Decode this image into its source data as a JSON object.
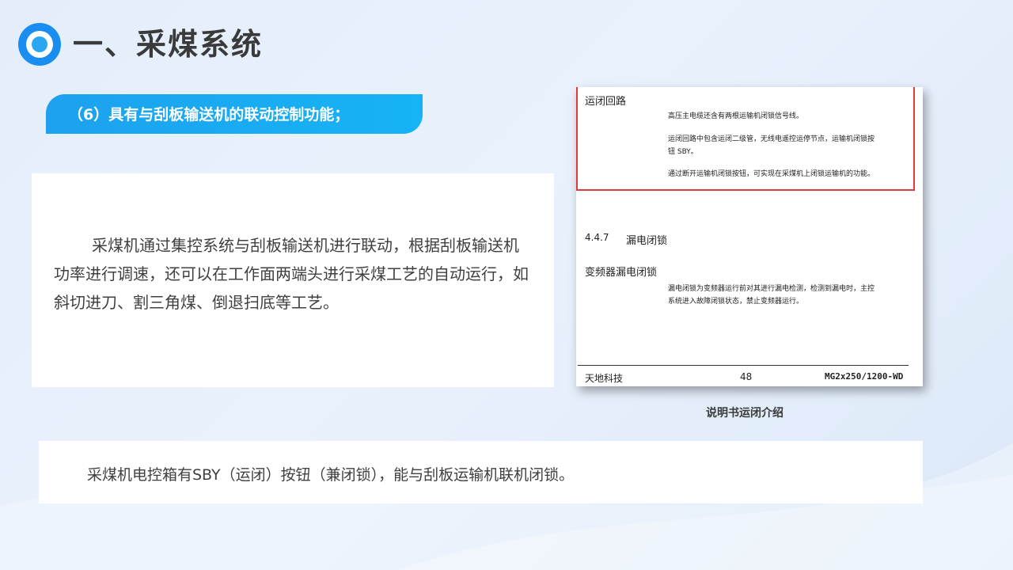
{
  "title": "一、采煤系统",
  "subtitle": "（6）具有与刮板输送机的联动控制功能；",
  "paragraph_1": "采煤机通过集控系统与刮板输送机进行联动，根据刮板输送机功率进行调速，还可以在工作面两端头进行采煤工艺的自动运行，如斜切进刀、割三角煤、倒退扫底等工艺。",
  "doc_image": {
    "heading_1": "运闭回路",
    "line_1": "高压主电缆还含有两根运输机闭锁信号线。",
    "line_2a": "运闭回路中包含运闭二级管，无线电遥控运停节点，运输机闭锁按",
    "line_2b": "钮 SBY。",
    "line_3": "通过断开运输机闭锁按钮，可实现在采煤机上闭锁运输机的功能。",
    "section_number": "4.4.7",
    "section_title": "漏电闭锁",
    "heading_2": "变频器漏电闭锁",
    "line_4a": "漏电闭锁为变频器运行前对其进行漏电检测，检测到漏电时，主控",
    "line_4b": "系统进入故障闭锁状态，禁止变频器运行。",
    "footer_left": "天地科技",
    "footer_page": "48",
    "footer_right": "MG2x250/1200-WD"
  },
  "caption": "说明书运闭介绍",
  "paragraph_2": "采煤机电控箱有SBY（运闭）按钮（兼闭锁），能与刮板运输机联机闭锁。",
  "colors": {
    "accent": "#1da1ef",
    "title_text": "#3a3a3a",
    "body_text": "#404040",
    "red_box": "#e03b3b"
  }
}
